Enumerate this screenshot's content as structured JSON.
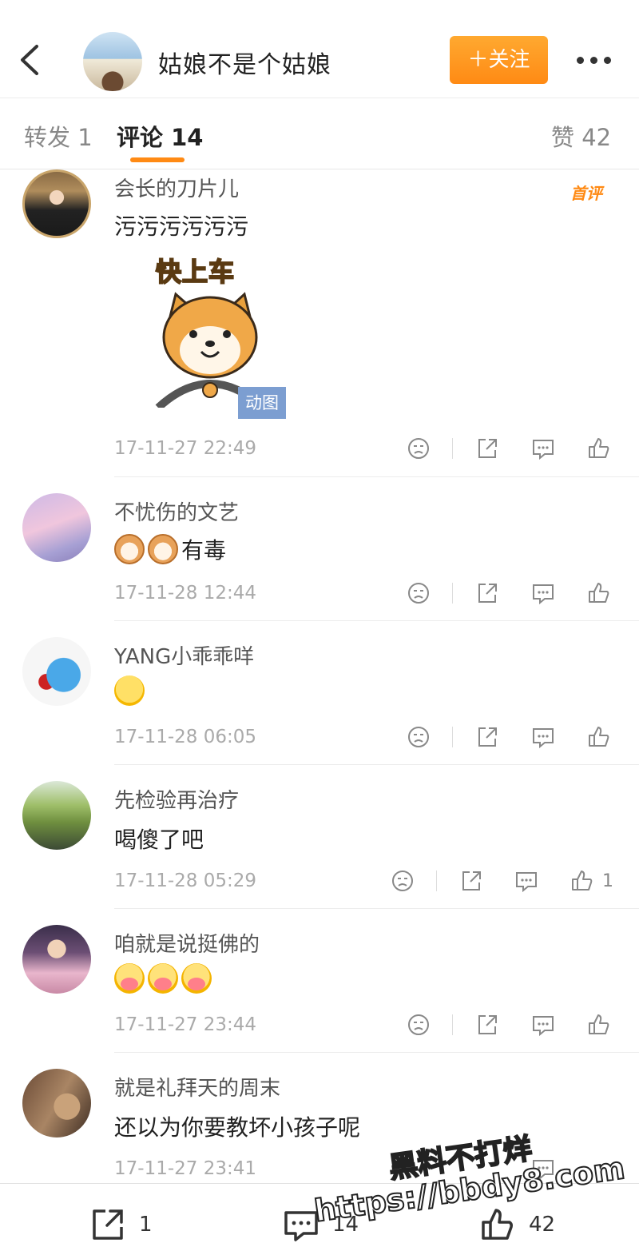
{
  "header": {
    "title": "姑娘不是个姑娘",
    "follow_label": "＋关注"
  },
  "tabs": {
    "repost": "转发 1",
    "comments": "评论 14",
    "likes": "赞 42"
  },
  "comments": [
    {
      "name": "会长的刀片儿",
      "badge": "首评",
      "text": "污污污污污污",
      "gif_text": "快上车",
      "gif_badge": "动图",
      "time": "17-11-27 22:49"
    },
    {
      "name": "不忧伤的文艺",
      "text": "有毒",
      "time": "17-11-28 12:44"
    },
    {
      "name": "YANG小乖乖咩",
      "text": "",
      "time": "17-11-28 06:05"
    },
    {
      "name": "先检验再治疗",
      "text": "喝傻了吧",
      "time": "17-11-28 05:29",
      "like_count": "1"
    },
    {
      "name": "咱就是说挺佛的",
      "text": "",
      "time": "17-11-27 23:44"
    },
    {
      "name": "就是礼拜天的周末",
      "text": "还以为你要教坏小孩子呢",
      "time": "17-11-27 23:41"
    }
  ],
  "bottom_bar": {
    "repost_count": "1",
    "comment_count": "14",
    "like_count": "42"
  },
  "watermark": {
    "line1": "黑料不打烊",
    "line2": "https://bbdy8.com"
  },
  "colors": {
    "accent": "#ff8a14",
    "gif_badge": "#7c9ed1"
  }
}
